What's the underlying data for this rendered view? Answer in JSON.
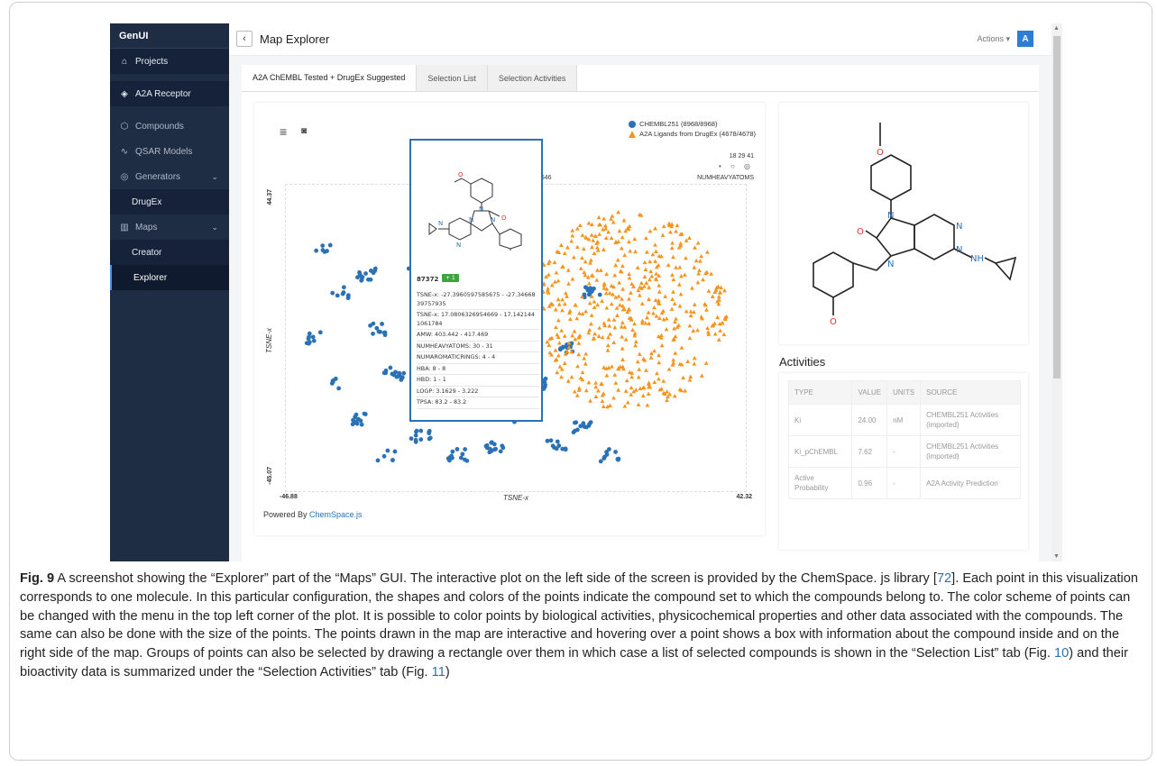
{
  "app": {
    "brand": "GenUI"
  },
  "sidebar": {
    "items": [
      {
        "label": "Projects",
        "icon": "home-icon"
      },
      {
        "label": "A2A Receptor",
        "icon": "layers-icon"
      },
      {
        "label": "Compounds",
        "icon": "cube-icon"
      },
      {
        "label": "QSAR Models",
        "icon": "pulse-icon"
      },
      {
        "label": "Generators",
        "icon": "compass-icon"
      },
      {
        "label": "DrugEx"
      },
      {
        "label": "Maps",
        "icon": "map-icon"
      },
      {
        "label": "Creator"
      },
      {
        "label": "Explorer"
      }
    ]
  },
  "topbar": {
    "back": "‹",
    "title": "Map Explorer",
    "actions": "Actions ▾",
    "avatar": "A"
  },
  "tabs": [
    {
      "label": "A2A ChEMBL Tested + DrugEx Suggested"
    },
    {
      "label": "Selection List"
    },
    {
      "label": "Selection Activities"
    }
  ],
  "plot": {
    "menu_icon": "≡",
    "camera_icon": "◙",
    "legend": [
      {
        "label": "CHEMBL251 (8968/8968)",
        "color": "#2a72b5",
        "shape": "circle"
      },
      {
        "label": "A2A Ligands from DrugEx (4678/4678)",
        "color": "#f7941d",
        "shape": "triangle"
      }
    ],
    "size_legend_values": "18  29  41",
    "size_marks": "• ○ ◎",
    "size_property": "NUMHEAVYATOMS",
    "top_value": "13646",
    "y_max": "44.37",
    "y_min": "-45.07",
    "x_min": "-46.88",
    "x_max": "42.32",
    "x_label": "TSNE-x",
    "y_label": "TSNE-x"
  },
  "tooltip": {
    "id": "87372",
    "badge": "+ 1",
    "lines": [
      "TSNE-x:  -27.3960597585675 - -27.34668 39757935",
      "TSNE-x:  17.0806326954669 - 17.142144 1061784",
      "AMW:  403.442 - 417.469",
      "NUMHEAVYATOMS:  30 - 31",
      "NUMAROMATICRINGS:  4 - 4",
      "HBA:  8 - 8",
      "HBD:  1 - 1",
      "LOGP:  3.1629 - 3.222",
      "TPSA:  83.2 - 83.2"
    ]
  },
  "powered": {
    "prefix": "Powered By ",
    "link": "ChemSpace.js"
  },
  "activities": {
    "title": "Activities",
    "headers": [
      "TYPE",
      "VALUE",
      "UNITS",
      "SOURCE"
    ],
    "rows": [
      [
        "Ki",
        "24.00",
        "nM",
        "CHEMBL251 Activities (imported)"
      ],
      [
        "Ki_pChEMBL",
        "7.62",
        "-",
        "CHEMBL251 Activities (imported)"
      ],
      [
        "Active Probability",
        "0.96",
        "-",
        "A2A Activity Prediction"
      ]
    ]
  },
  "caption": {
    "label": "Fig. 9",
    "text_1": "  A screenshot showing the “Explorer” part of the “Maps” GUI. The interactive plot on the left side of the screen is provided by the ChemSpace. js library [",
    "ref_1": "72",
    "text_2": "]. Each point in this visualization corresponds to one molecule. In this particular configuration, the shapes and colors of the points indicate the compound set to which the compounds belong to. The color scheme of points can be changed with the menu in the top left corner of the plot. It is possible to color points by biological activities, physicochemical properties and other data associated with the compounds. The same can also be done with the size of the points. The points drawn in the map are interactive and hovering over a point shows a box with information about the compound inside and on the right side of the map. Groups of points can also be selected by drawing a rectangle over them in which case a list of selected compounds is shown in the “Selection List” tab (Fig. ",
    "ref_2": "10",
    "text_3": ") and their bioactivity data is summarized under the “Selection Activities” tab (Fig. ",
    "ref_3": "11",
    "text_4": ")"
  },
  "colors": {
    "sidebar": "#1f2d44",
    "accent": "#2a72b5",
    "drugex": "#f7941d",
    "badge": "#3fa33f"
  }
}
